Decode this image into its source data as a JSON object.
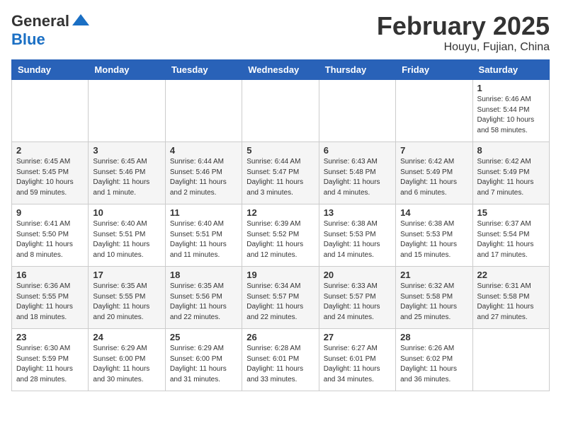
{
  "header": {
    "logo_line1": "General",
    "logo_line2": "Blue",
    "month_title": "February 2025",
    "location": "Houyu, Fujian, China"
  },
  "days_of_week": [
    "Sunday",
    "Monday",
    "Tuesday",
    "Wednesday",
    "Thursday",
    "Friday",
    "Saturday"
  ],
  "weeks": [
    [
      {
        "day": "",
        "text": ""
      },
      {
        "day": "",
        "text": ""
      },
      {
        "day": "",
        "text": ""
      },
      {
        "day": "",
        "text": ""
      },
      {
        "day": "",
        "text": ""
      },
      {
        "day": "",
        "text": ""
      },
      {
        "day": "1",
        "text": "Sunrise: 6:46 AM\nSunset: 5:44 PM\nDaylight: 10 hours and 58 minutes."
      }
    ],
    [
      {
        "day": "2",
        "text": "Sunrise: 6:45 AM\nSunset: 5:45 PM\nDaylight: 10 hours and 59 minutes."
      },
      {
        "day": "3",
        "text": "Sunrise: 6:45 AM\nSunset: 5:46 PM\nDaylight: 11 hours and 1 minute."
      },
      {
        "day": "4",
        "text": "Sunrise: 6:44 AM\nSunset: 5:46 PM\nDaylight: 11 hours and 2 minutes."
      },
      {
        "day": "5",
        "text": "Sunrise: 6:44 AM\nSunset: 5:47 PM\nDaylight: 11 hours and 3 minutes."
      },
      {
        "day": "6",
        "text": "Sunrise: 6:43 AM\nSunset: 5:48 PM\nDaylight: 11 hours and 4 minutes."
      },
      {
        "day": "7",
        "text": "Sunrise: 6:42 AM\nSunset: 5:49 PM\nDaylight: 11 hours and 6 minutes."
      },
      {
        "day": "8",
        "text": "Sunrise: 6:42 AM\nSunset: 5:49 PM\nDaylight: 11 hours and 7 minutes."
      }
    ],
    [
      {
        "day": "9",
        "text": "Sunrise: 6:41 AM\nSunset: 5:50 PM\nDaylight: 11 hours and 8 minutes."
      },
      {
        "day": "10",
        "text": "Sunrise: 6:40 AM\nSunset: 5:51 PM\nDaylight: 11 hours and 10 minutes."
      },
      {
        "day": "11",
        "text": "Sunrise: 6:40 AM\nSunset: 5:51 PM\nDaylight: 11 hours and 11 minutes."
      },
      {
        "day": "12",
        "text": "Sunrise: 6:39 AM\nSunset: 5:52 PM\nDaylight: 11 hours and 12 minutes."
      },
      {
        "day": "13",
        "text": "Sunrise: 6:38 AM\nSunset: 5:53 PM\nDaylight: 11 hours and 14 minutes."
      },
      {
        "day": "14",
        "text": "Sunrise: 6:38 AM\nSunset: 5:53 PM\nDaylight: 11 hours and 15 minutes."
      },
      {
        "day": "15",
        "text": "Sunrise: 6:37 AM\nSunset: 5:54 PM\nDaylight: 11 hours and 17 minutes."
      }
    ],
    [
      {
        "day": "16",
        "text": "Sunrise: 6:36 AM\nSunset: 5:55 PM\nDaylight: 11 hours and 18 minutes."
      },
      {
        "day": "17",
        "text": "Sunrise: 6:35 AM\nSunset: 5:55 PM\nDaylight: 11 hours and 20 minutes."
      },
      {
        "day": "18",
        "text": "Sunrise: 6:35 AM\nSunset: 5:56 PM\nDaylight: 11 hours and 22 minutes."
      },
      {
        "day": "19",
        "text": "Sunrise: 6:34 AM\nSunset: 5:57 PM\nDaylight: 11 hours and 22 minutes."
      },
      {
        "day": "20",
        "text": "Sunrise: 6:33 AM\nSunset: 5:57 PM\nDaylight: 11 hours and 24 minutes."
      },
      {
        "day": "21",
        "text": "Sunrise: 6:32 AM\nSunset: 5:58 PM\nDaylight: 11 hours and 25 minutes."
      },
      {
        "day": "22",
        "text": "Sunrise: 6:31 AM\nSunset: 5:58 PM\nDaylight: 11 hours and 27 minutes."
      }
    ],
    [
      {
        "day": "23",
        "text": "Sunrise: 6:30 AM\nSunset: 5:59 PM\nDaylight: 11 hours and 28 minutes."
      },
      {
        "day": "24",
        "text": "Sunrise: 6:29 AM\nSunset: 6:00 PM\nDaylight: 11 hours and 30 minutes."
      },
      {
        "day": "25",
        "text": "Sunrise: 6:29 AM\nSunset: 6:00 PM\nDaylight: 11 hours and 31 minutes."
      },
      {
        "day": "26",
        "text": "Sunrise: 6:28 AM\nSunset: 6:01 PM\nDaylight: 11 hours and 33 minutes."
      },
      {
        "day": "27",
        "text": "Sunrise: 6:27 AM\nSunset: 6:01 PM\nDaylight: 11 hours and 34 minutes."
      },
      {
        "day": "28",
        "text": "Sunrise: 6:26 AM\nSunset: 6:02 PM\nDaylight: 11 hours and 36 minutes."
      },
      {
        "day": "",
        "text": ""
      }
    ]
  ]
}
